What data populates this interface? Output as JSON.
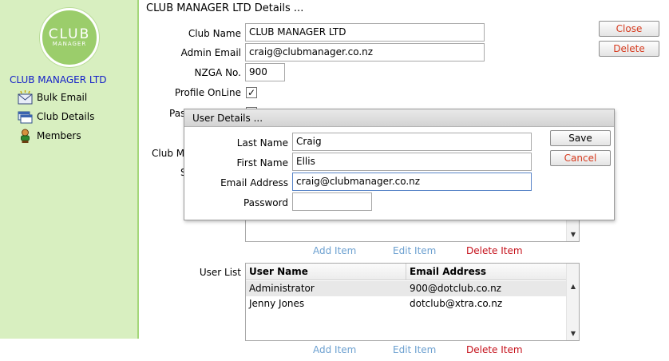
{
  "sidebar": {
    "logo_top": "CLUB",
    "logo_bottom": "MANAGER",
    "club_name": "CLUB MANAGER LTD",
    "items": [
      {
        "label": "Bulk Email",
        "icon": "envelope-icon"
      },
      {
        "label": "Club Details",
        "icon": "folder-window-icon"
      },
      {
        "label": "Members",
        "icon": "person-icon"
      }
    ]
  },
  "main": {
    "title": "CLUB MANAGER LTD Details ...",
    "club_name_label": "Club Name",
    "club_name_value": "CLUB MANAGER LTD",
    "admin_email_label": "Admin Email",
    "admin_email_value": "craig@clubmanager.co.nz",
    "nzga_label": "NZGA No.",
    "nzga_value": "900",
    "profile_online_label": "Profile OnLine",
    "profile_online_checked": "✓",
    "partial_label_1": "Pas",
    "partial_label_2": "Club Ma",
    "partial_label_3": "S",
    "close_label": "Close",
    "delete_label": "Delete",
    "list1_actions": {
      "add": "Add Item",
      "edit": "Edit Item",
      "delete": "Delete Item"
    },
    "user_list_label": "User List",
    "user_list": {
      "columns": [
        "User Name",
        "Email Address"
      ],
      "rows": [
        [
          "Administrator",
          "900@dotclub.co.nz"
        ],
        [
          "Jenny Jones",
          "dotclub@xtra.co.nz"
        ]
      ]
    },
    "list2_actions": {
      "add": "Add Item",
      "edit": "Edit Item",
      "delete": "Delete Item"
    }
  },
  "dialog": {
    "title": "User Details ...",
    "last_name_label": "Last Name",
    "last_name_value": "Craig",
    "first_name_label": "First Name",
    "first_name_value": "Ellis",
    "email_label": "Email Address",
    "email_value": "craig@clubmanager.co.nz",
    "password_label": "Password",
    "password_value": "",
    "save_label": "Save",
    "cancel_label": "Cancel"
  },
  "colors": {
    "sidebar_bg": "#d8efc0",
    "club_name": "#1420c8",
    "link_blue": "#6ca0d0",
    "link_red": "#c5101a"
  }
}
